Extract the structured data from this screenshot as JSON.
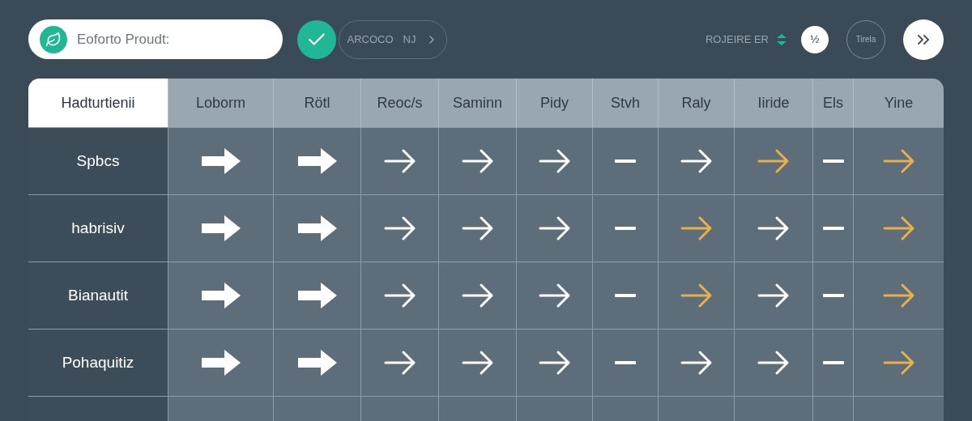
{
  "toolbar": {
    "search": {
      "value": "Eoforto Proudt:"
    },
    "filter": {
      "label": "ARCOCO",
      "count": "NJ"
    },
    "status_label": "ROJEIRE ER",
    "page_badge": "½",
    "mode_button": "Tirela"
  },
  "table": {
    "columns": [
      "Hadturtienii",
      "Loborm",
      "Rötl",
      "Reoc/s",
      "Saminn",
      "Pidy",
      "Stvh",
      "Raly",
      "Iiride",
      "Els",
      "Yine"
    ],
    "rows": [
      {
        "label": "Spbcs",
        "cells": [
          {
            "kind": "bold",
            "highlight": false
          },
          {
            "kind": "bold",
            "highlight": false
          },
          {
            "kind": "arrow",
            "highlight": false
          },
          {
            "kind": "arrow",
            "highlight": false
          },
          {
            "kind": "arrow",
            "highlight": false
          },
          {
            "kind": "dash",
            "highlight": false
          },
          {
            "kind": "arrow",
            "highlight": false
          },
          {
            "kind": "arrow",
            "highlight": true
          },
          {
            "kind": "dash",
            "highlight": false
          },
          {
            "kind": "arrow",
            "highlight": true
          }
        ]
      },
      {
        "label": "habrisiv",
        "cells": [
          {
            "kind": "bold",
            "highlight": false
          },
          {
            "kind": "bold",
            "highlight": false
          },
          {
            "kind": "arrow",
            "highlight": false
          },
          {
            "kind": "arrow",
            "highlight": false
          },
          {
            "kind": "arrow",
            "highlight": false
          },
          {
            "kind": "dash",
            "highlight": false
          },
          {
            "kind": "arrow",
            "highlight": true
          },
          {
            "kind": "arrow",
            "highlight": false
          },
          {
            "kind": "dash",
            "highlight": false
          },
          {
            "kind": "arrow",
            "highlight": true
          }
        ]
      },
      {
        "label": "Bianautit",
        "cells": [
          {
            "kind": "bold",
            "highlight": false
          },
          {
            "kind": "bold",
            "highlight": false
          },
          {
            "kind": "arrow",
            "highlight": false
          },
          {
            "kind": "arrow",
            "highlight": false
          },
          {
            "kind": "arrow",
            "highlight": false
          },
          {
            "kind": "dash",
            "highlight": false
          },
          {
            "kind": "arrow",
            "highlight": true
          },
          {
            "kind": "arrow",
            "highlight": false
          },
          {
            "kind": "dash",
            "highlight": false
          },
          {
            "kind": "arrow",
            "highlight": true
          }
        ]
      },
      {
        "label": "Pohaquitiz",
        "cells": [
          {
            "kind": "bold",
            "highlight": false
          },
          {
            "kind": "bold",
            "highlight": false
          },
          {
            "kind": "arrow",
            "highlight": false
          },
          {
            "kind": "arrow",
            "highlight": false
          },
          {
            "kind": "arrow",
            "highlight": false
          },
          {
            "kind": "dash",
            "highlight": false
          },
          {
            "kind": "arrow",
            "highlight": false
          },
          {
            "kind": "arrow",
            "highlight": false
          },
          {
            "kind": "dash",
            "highlight": false
          },
          {
            "kind": "arrow",
            "highlight": true
          }
        ]
      }
    ]
  }
}
